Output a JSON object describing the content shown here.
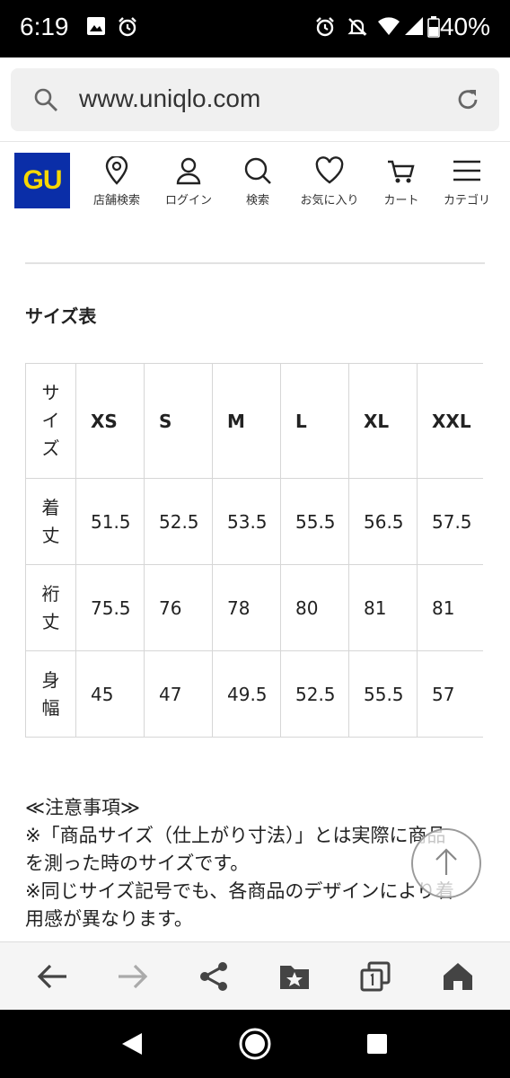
{
  "status_bar": {
    "time": "6:19",
    "battery": "40%"
  },
  "browser": {
    "url": "www.uniqlo.com"
  },
  "brand": {
    "logo_text": "GU",
    "logo_bg": "#0a2ea8",
    "logo_fg": "#f7d800"
  },
  "nav": {
    "items": [
      {
        "label": "店舗検索",
        "icon": "location-pin-icon"
      },
      {
        "label": "ログイン",
        "icon": "person-icon"
      },
      {
        "label": "検索",
        "icon": "search-icon"
      },
      {
        "label": "お気に入り",
        "icon": "heart-icon"
      },
      {
        "label": "カート",
        "icon": "cart-icon"
      },
      {
        "label": "カテゴリ",
        "icon": "menu-icon"
      }
    ]
  },
  "size_table": {
    "title": "サイズ表",
    "header_label": "サイズ",
    "sizes": [
      "XS",
      "S",
      "M",
      "L",
      "XL",
      "XXL"
    ],
    "rows": [
      {
        "label": "着丈",
        "values": [
          "51.5",
          "52.5",
          "53.5",
          "55.5",
          "56.5",
          "57.5"
        ]
      },
      {
        "label": "裄丈",
        "values": [
          "75.5",
          "76",
          "78",
          "80",
          "81",
          "81"
        ]
      },
      {
        "label": "身幅",
        "values": [
          "45",
          "47",
          "49.5",
          "52.5",
          "55.5",
          "57"
        ]
      }
    ]
  },
  "notes": {
    "heading": "≪注意事項≫",
    "lines": [
      "※「商品サイズ（仕上がり寸法）」とは実際に商品",
      "を測った時のサイズです。",
      "※同じサイズ記号でも、各商品のデザインにより着",
      "用感が異なります。"
    ]
  }
}
